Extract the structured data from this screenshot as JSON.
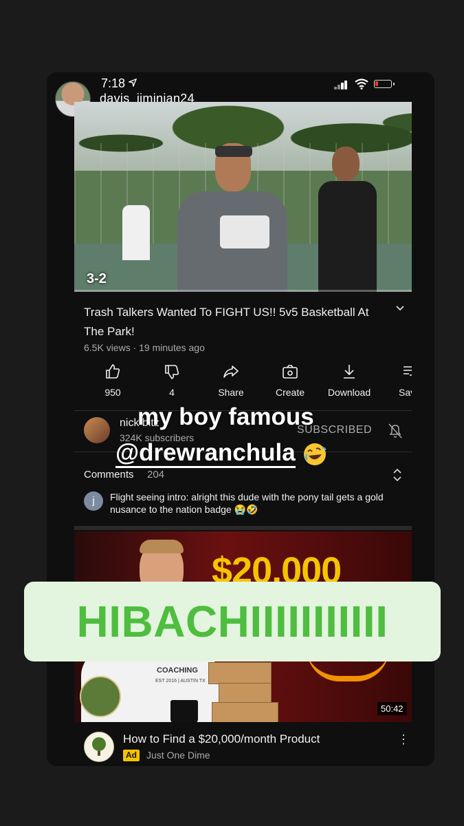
{
  "status_bar": {
    "time": "7:18",
    "location_icon": "location-arrow-icon",
    "battery_color": "#e33333"
  },
  "story": {
    "username": "davis_jiminian24"
  },
  "video": {
    "score_overlay": "3-2",
    "title": "Trash Talkers Wanted To FIGHT US!! 5v5 Basketball At The Park!",
    "meta": "6.5K views · 19 minutes ago",
    "progress": 0
  },
  "actions": [
    {
      "icon": "thumbs-up-icon",
      "label": "950"
    },
    {
      "icon": "thumbs-down-icon",
      "label": "4"
    },
    {
      "icon": "share-icon",
      "label": "Share"
    },
    {
      "icon": "create-icon",
      "label": "Create"
    },
    {
      "icon": "download-icon",
      "label": "Download"
    },
    {
      "icon": "save-icon",
      "label": "Sav"
    }
  ],
  "channel": {
    "name": "nick bitz",
    "subscribers": "324K subscribers",
    "subscribed_label": "SUBSCRIBED"
  },
  "comments": {
    "label": "Comments",
    "count": "204",
    "first": {
      "avatar_letter": "j",
      "text": "Flight seeing intro:  alright this dude with the pony tail gets a gold nusance to the nation badge 😭🤣"
    }
  },
  "next_video": {
    "thumbnail_text": "$20,000",
    "shirt_text": "COACHING",
    "shirt_subtext": "EST 2016 | AUSTIN TX",
    "duration": "50:42",
    "title": "How to Find a $20,000/month Product",
    "ad_badge": "Ad",
    "channel": "Just One Dime"
  },
  "stickers": {
    "line1": "my boy famous",
    "mention": "@drewranchula",
    "emoji": "rolling-laughing-emoji",
    "banner": "HIBACHIIIIIIIIIII",
    "banner_bg": "#e3f5df",
    "banner_color": "#4fbd3f"
  }
}
